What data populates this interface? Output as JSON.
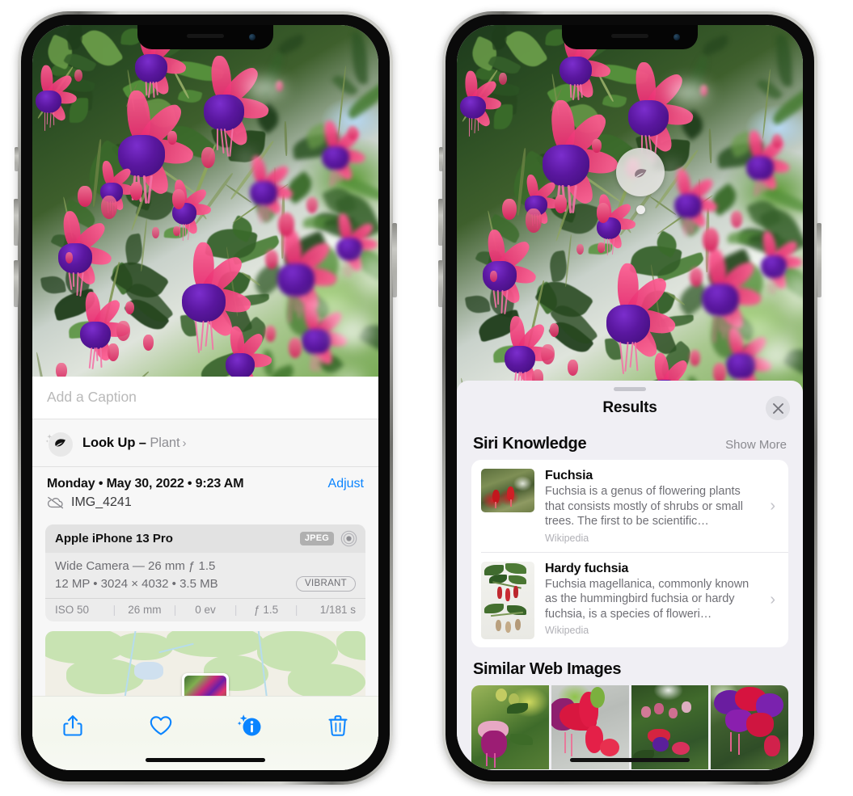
{
  "left_phone": {
    "photo": {
      "alt": "fuchsia-flowers-hanging-basket"
    },
    "caption": {
      "placeholder": "Add a Caption",
      "value": ""
    },
    "lookup": {
      "icon": "leaf-icon",
      "sparkle_icon": "sparkle-icon",
      "label": "Look Up",
      "dash": " – ",
      "subject": "Plant",
      "chevron": "›"
    },
    "meta": {
      "date": "Monday • May 30, 2022 • 9:23 AM",
      "adjust_label": "Adjust",
      "cloud_icon": "cloud-slash-icon",
      "filename": "IMG_4241"
    },
    "exif": {
      "model": "Apple iPhone 13 Pro",
      "format_chip": "JPEG",
      "aperture_icon": "aperture-icon",
      "lens": "Wide Camera — 26 mm ƒ 1.5",
      "size": "12 MP • 3024 × 4032 • 3.5 MB",
      "style_chip": "VIBRANT",
      "stats": [
        "ISO 50",
        "26 mm",
        "0 ev",
        "ƒ 1.5",
        "1/181 s"
      ]
    },
    "map": {
      "label": "location-map-preview"
    },
    "toolbar": [
      {
        "name": "share-icon",
        "label": "Share"
      },
      {
        "name": "heart-icon",
        "label": "Favorite"
      },
      {
        "name": "info-icon",
        "label": "Info"
      },
      {
        "name": "trash-icon",
        "label": "Delete"
      }
    ],
    "accent_color": "#0a84ff"
  },
  "right_phone": {
    "photo": {
      "alt": "fuchsia-flowers-hanging-basket"
    },
    "visual_lookup_badge": {
      "icon": "leaf-icon",
      "label": "Visual Look Up"
    },
    "sheet": {
      "grabber": "drag-handle",
      "title": "Results",
      "close_icon": "close-icon",
      "siri_knowledge": {
        "title": "Siri Knowledge",
        "action": "Show More",
        "results": [
          {
            "title": "Fuchsia",
            "description": "Fuchsia is a genus of flowering plants that consists mostly of shrubs or small trees. The first to be scientific…",
            "source": "Wikipedia",
            "chevron": "›"
          },
          {
            "title": "Hardy fuchsia",
            "description": "Fuchsia magellanica, commonly known as the hummingbird fuchsia or hardy fuchsia, is a species of floweri…",
            "source": "Wikipedia",
            "chevron": "›"
          }
        ]
      },
      "similar_web_images": {
        "title": "Similar Web Images",
        "thumbnails": [
          "fuchsia-pink-white-bloom",
          "fuchsia-red-closeup",
          "fuchsia-bush-buds",
          "fuchsia-purple-red-double"
        ]
      }
    }
  },
  "colors": {
    "accent_blue": "#0a84ff",
    "sheet_bg": "#f0eff4",
    "panel_bg": "#f7f7f7",
    "card_bg": "#ececec",
    "secondary_text": "#8e8e93"
  }
}
